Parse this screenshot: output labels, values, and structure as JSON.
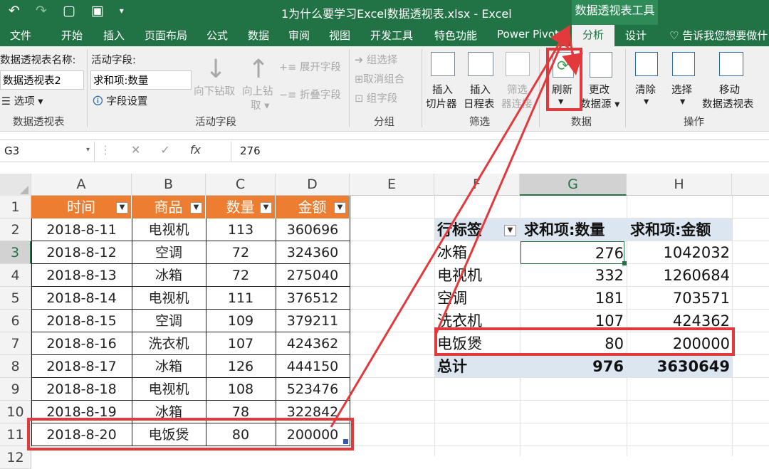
{
  "title_bar": {
    "document_title": "1为什么要学习Excel数据透视表.xlsx - Excel",
    "context_tools": "数据透视表工具"
  },
  "tabs": [
    "文件",
    "开始",
    "插入",
    "页面布局",
    "公式",
    "数据",
    "审阅",
    "视图",
    "开发工具",
    "特色功能",
    "Power Pivot",
    "分析",
    "设计"
  ],
  "active_tab": "分析",
  "tell_me": "告诉我您想要做什",
  "ribbon": {
    "pivot_name_label": "数据透视表名称:",
    "pivot_name_value": "数据透视表2",
    "options_label": "选项",
    "group_pivot": "数据透视表",
    "active_field_label": "活动字段:",
    "active_field_value": "求和项:数量",
    "field_settings": "字段设置",
    "drill_down": "向下钻取",
    "drill_up_1": "向上钻",
    "drill_up_2": "取",
    "expand_field": "展开字段",
    "collapse_field": "折叠字段",
    "group_active_field": "活动字段",
    "group_selection": "组选择",
    "ungroup": "取消组合",
    "group_field": "组字段",
    "group_group": "分组",
    "insert_slicer_1": "插入",
    "insert_slicer_2": "切片器",
    "insert_timeline_1": "插入",
    "insert_timeline_2": "日程表",
    "filter_conn_1": "筛选",
    "filter_conn_2": "器连接",
    "group_filter": "筛选",
    "refresh": "刷新",
    "change_source_1": "更改",
    "change_source_2": "数据源",
    "group_data": "数据",
    "clear": "清除",
    "select": "选择",
    "move_1": "移动",
    "move_2": "数据透视表",
    "group_actions": "操作"
  },
  "formula_bar": {
    "name_box": "G3",
    "formula": "276"
  },
  "columns": [
    "A",
    "B",
    "C",
    "D",
    "E",
    "F",
    "G",
    "H"
  ],
  "rows": [
    "1",
    "2",
    "3",
    "4",
    "5",
    "6",
    "7",
    "8",
    "9",
    "10",
    "11",
    "12"
  ],
  "source_table": {
    "headers": [
      "时间",
      "商品",
      "数量",
      "金额"
    ],
    "rows": [
      [
        "2018-8-11",
        "电视机",
        "113",
        "360696"
      ],
      [
        "2018-8-12",
        "空调",
        "72",
        "324360"
      ],
      [
        "2018-8-13",
        "冰箱",
        "72",
        "275040"
      ],
      [
        "2018-8-14",
        "电视机",
        "111",
        "376512"
      ],
      [
        "2018-8-15",
        "空调",
        "109",
        "379211"
      ],
      [
        "2018-8-16",
        "洗衣机",
        "107",
        "424362"
      ],
      [
        "2018-8-17",
        "冰箱",
        "126",
        "444150"
      ],
      [
        "2018-8-18",
        "电视机",
        "108",
        "523476"
      ],
      [
        "2018-8-19",
        "冰箱",
        "78",
        "322842"
      ],
      [
        "2018-8-20",
        "电饭煲",
        "80",
        "200000"
      ]
    ]
  },
  "pivot_table": {
    "headers": [
      "行标签",
      "求和项:数量",
      "求和项:金额"
    ],
    "rows": [
      [
        "冰箱",
        "276",
        "1042032"
      ],
      [
        "电视机",
        "332",
        "1260684"
      ],
      [
        "空调",
        "181",
        "703571"
      ],
      [
        "洗衣机",
        "107",
        "424362"
      ],
      [
        "电饭煲",
        "80",
        "200000"
      ]
    ],
    "total": [
      "总计",
      "976",
      "3630649"
    ]
  },
  "colors": {
    "excel_green": "#217346",
    "header_orange": "#ed7d31",
    "pivot_header": "#dce6f1",
    "highlight_red": "#e2393d"
  }
}
